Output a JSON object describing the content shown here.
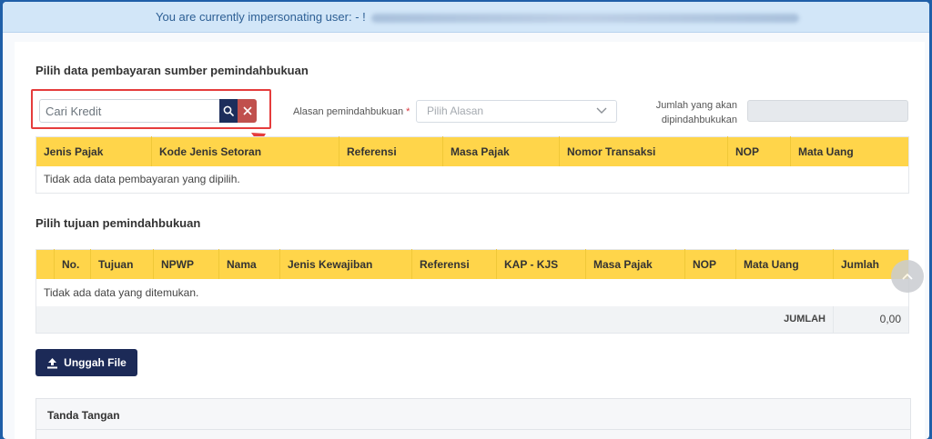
{
  "banner": {
    "text": "You are currently impersonating user: - !"
  },
  "source_section": {
    "title": "Pilih data pembayaran sumber pemindahbukuan",
    "search_placeholder": "Cari Kredit",
    "reason_label": "Alasan pemindahbukuan",
    "reason_required": "*",
    "reason_select_value": "Pilih Alasan",
    "amount_label_line1": "Jumlah yang akan",
    "amount_label_line2": "dipindahbukukan",
    "table": {
      "headers": [
        "Jenis Pajak",
        "Kode Jenis Setoran",
        "Referensi",
        "Masa Pajak",
        "Nomor Transaksi",
        "NOP",
        "Mata Uang"
      ],
      "empty_message": "Tidak ada data pembayaran yang dipilih."
    }
  },
  "target_section": {
    "title": "Pilih tujuan pemindahbukuan",
    "table": {
      "headers": [
        "",
        "No.",
        "Tujuan",
        "NPWP",
        "Nama",
        "Jenis Kewajiban",
        "Referensi",
        "KAP - KJS",
        "Masa Pajak",
        "NOP",
        "Mata Uang",
        "Jumlah"
      ],
      "empty_message": "Tidak ada data yang ditemukan.",
      "total_label": "JUMLAH",
      "total_value": "0,00"
    }
  },
  "upload_button_label": "Unggah File",
  "signature_panel_title": "Tanda Tangan",
  "colors": {
    "header_yellow": "#ffd54a",
    "primary_navy": "#1d2e5c",
    "danger_red": "#c0504d",
    "highlight_red": "#e53c3c"
  },
  "icons": {
    "search": "search-icon",
    "clear": "close-icon",
    "dropdown": "chevron-down-icon",
    "upload": "upload-icon",
    "scroll_top": "chevron-up-icon"
  }
}
